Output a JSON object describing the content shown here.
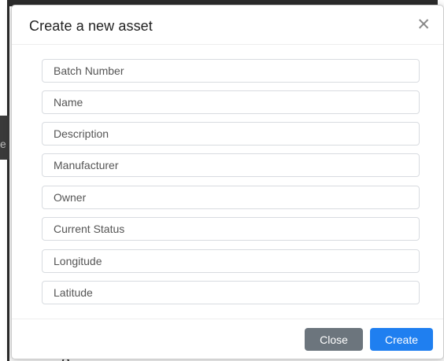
{
  "modal": {
    "title": "Create a new asset",
    "close_icon": "close-icon"
  },
  "fields": [
    {
      "name": "batch-number-input",
      "placeholder": "Batch Number",
      "value": ""
    },
    {
      "name": "name-input",
      "placeholder": "Name",
      "value": ""
    },
    {
      "name": "description-input",
      "placeholder": "Description",
      "value": ""
    },
    {
      "name": "manufacturer-input",
      "placeholder": "Manufacturer",
      "value": ""
    },
    {
      "name": "owner-input",
      "placeholder": "Owner",
      "value": ""
    },
    {
      "name": "current-status-input",
      "placeholder": "Current Status",
      "value": ""
    },
    {
      "name": "longitude-input",
      "placeholder": "Longitude",
      "value": ""
    },
    {
      "name": "latitude-input",
      "placeholder": "Latitude",
      "value": ""
    }
  ],
  "footer": {
    "close_label": "Close",
    "create_label": "Create"
  },
  "background": {
    "left_band_char": "e",
    "bottom_text": "g"
  },
  "colors": {
    "primary": "#1f7ff0",
    "secondary": "#6c757d"
  }
}
